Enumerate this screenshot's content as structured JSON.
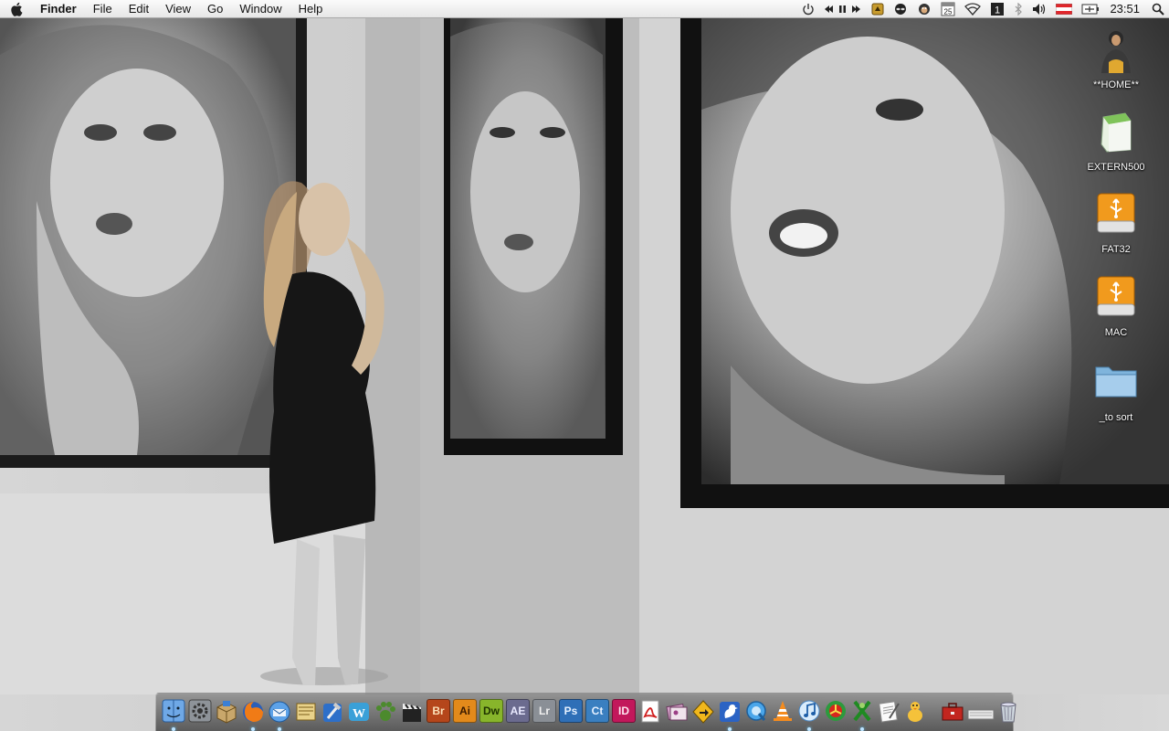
{
  "menubar": {
    "app_name": "Finder",
    "menus": [
      "File",
      "Edit",
      "View",
      "Go",
      "Window",
      "Help"
    ],
    "calendar_day": "25",
    "spaces_number": "1",
    "clock": "23:51"
  },
  "desktop_icons": [
    {
      "label": "**HOME**",
      "icon": "home-user-icon"
    },
    {
      "label": "EXTERN500",
      "icon": "external-drive-icon"
    },
    {
      "label": "FAT32",
      "icon": "usb-drive-icon"
    },
    {
      "label": "MAC",
      "icon": "usb-drive-icon"
    },
    {
      "label": "_to sort",
      "icon": "folder-icon"
    }
  ],
  "dock": {
    "apps": [
      {
        "name": "finder",
        "running": true
      },
      {
        "name": "system-preferences",
        "running": false
      },
      {
        "name": "package-utility",
        "running": false
      },
      {
        "name": "firefox",
        "running": true
      },
      {
        "name": "mail",
        "running": true
      },
      {
        "name": "script-editor",
        "running": false
      },
      {
        "name": "xcode",
        "running": false
      },
      {
        "name": "word-web",
        "running": false
      },
      {
        "name": "growl",
        "running": false
      },
      {
        "name": "final-cut",
        "running": false
      },
      {
        "name": "bridge",
        "label": "Br",
        "bg": "#b5461b",
        "fg": "#fbe0b8",
        "running": false
      },
      {
        "name": "illustrator",
        "label": "Ai",
        "bg": "#e38a1b",
        "fg": "#3a1a00",
        "running": false
      },
      {
        "name": "dreamweaver",
        "label": "Dw",
        "bg": "#88b52b",
        "fg": "#1f3300",
        "running": false
      },
      {
        "name": "after-effects",
        "label": "AE",
        "bg": "#6b6b8f",
        "fg": "#e9e9ff",
        "running": false
      },
      {
        "name": "lightroom",
        "label": "Lr",
        "bg": "#8a8f96",
        "fg": "#f0f0f0",
        "running": false
      },
      {
        "name": "photoshop",
        "label": "Ps",
        "bg": "#2f6fb7",
        "fg": "#e6f1ff",
        "running": false
      },
      {
        "name": "contribute",
        "label": "Ct",
        "bg": "#3a7fc0",
        "fg": "#e6f1ff",
        "running": false
      },
      {
        "name": "indesign",
        "label": "ID",
        "bg": "#c2185b",
        "fg": "#ffe6f0",
        "running": false
      },
      {
        "name": "acrobat",
        "running": false
      },
      {
        "name": "image-app",
        "running": false
      },
      {
        "name": "transmit",
        "running": false
      },
      {
        "name": "cyberduck",
        "running": true
      },
      {
        "name": "quicktime",
        "running": false
      },
      {
        "name": "vlc",
        "running": false
      },
      {
        "name": "itunes",
        "running": true
      },
      {
        "name": "burn",
        "running": false
      },
      {
        "name": "x11",
        "running": true
      },
      {
        "name": "textedit",
        "running": false
      },
      {
        "name": "adium",
        "running": false
      }
    ],
    "extras": [
      "toolbox",
      "keyboard",
      "trash"
    ]
  }
}
